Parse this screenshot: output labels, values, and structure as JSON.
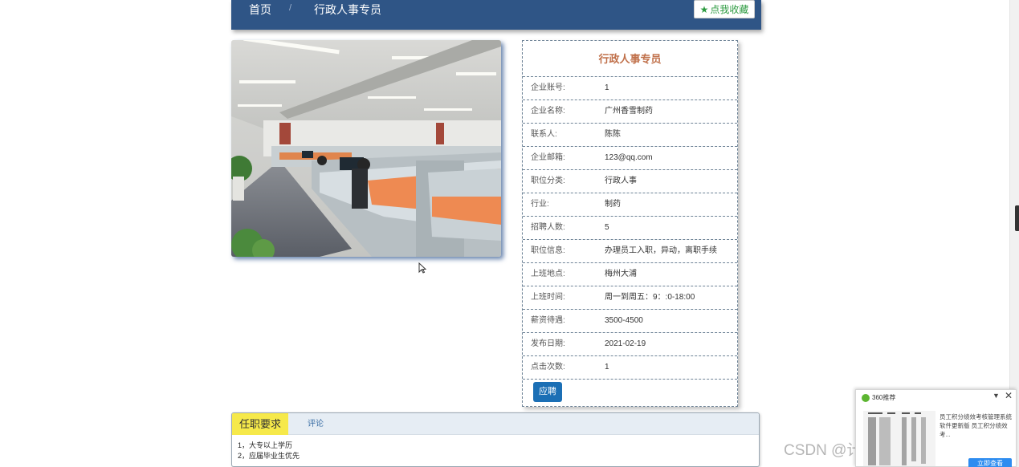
{
  "breadcrumb": {
    "home": "首页",
    "separator": "/",
    "current": "行政人事专员"
  },
  "favorite": {
    "label": "点我收藏",
    "icon": "star-icon"
  },
  "job": {
    "title": "行政人事专员",
    "fields": [
      {
        "label": "企业账号:",
        "value": "1"
      },
      {
        "label": "企业名称:",
        "value": "广州香雪制药"
      },
      {
        "label": "联系人:",
        "value": "陈陈"
      },
      {
        "label": "企业邮箱:",
        "value": "123@qq.com"
      },
      {
        "label": "职位分类:",
        "value": "行政人事"
      },
      {
        "label": "行业:",
        "value": "制药"
      },
      {
        "label": "招聘人数:",
        "value": "5"
      },
      {
        "label": "职位信息:",
        "value": "办理员工入职，异动，离职手续"
      },
      {
        "label": "上班地点:",
        "value": "梅州大浦"
      },
      {
        "label": "上班时间:",
        "value": "周一到周五：9：:0-18:00"
      },
      {
        "label": "薪资待遇:",
        "value": "3500-4500"
      },
      {
        "label": "发布日期:",
        "value": "2021-02-19"
      },
      {
        "label": "点击次数:",
        "value": "1"
      }
    ],
    "apply_label": "应聘"
  },
  "tabs": {
    "active": "任职要求",
    "comment": "评论",
    "requirements": [
      "1，大专以上学历",
      "2，应届毕业生优先"
    ]
  },
  "watermark": "CSDN @计算机毕业设计程",
  "popup": {
    "title": "360推荐",
    "text": "员工积分绩效考核管理系统软件更新版 员工积分绩效考...",
    "button": "立即查看"
  }
}
